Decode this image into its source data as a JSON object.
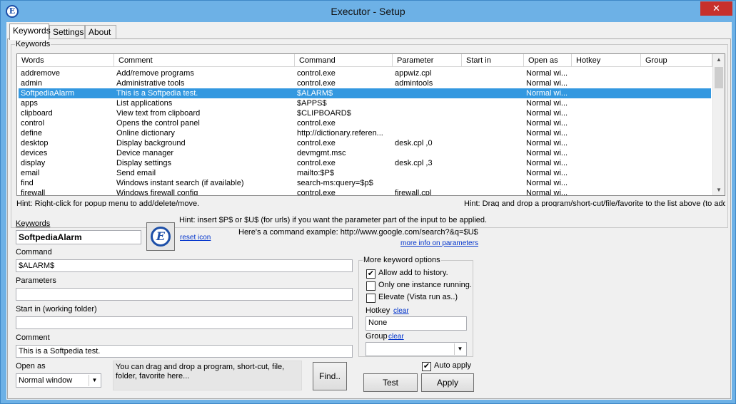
{
  "window": {
    "title": "Executor - Setup",
    "close_glyph": "✕",
    "app_icon": "executor-logo-icon",
    "app_icon_letter": "E"
  },
  "tabs": [
    {
      "label": "Keywords",
      "active": true
    },
    {
      "label": "Settings",
      "active": false
    },
    {
      "label": "About",
      "active": false
    }
  ],
  "keywords_group": {
    "label": "Keywords",
    "columns": [
      "Words",
      "Comment",
      "Command",
      "Parameter",
      "Start in",
      "Open as",
      "Hotkey",
      "Group"
    ],
    "rows": [
      {
        "words": "addremove",
        "comment": "Add/remove programs",
        "command": "control.exe",
        "parameter": "appwiz.cpl",
        "start_in": "",
        "open_as": "Normal wi...",
        "hotkey": "",
        "group": "",
        "selected": false
      },
      {
        "words": "admin",
        "comment": "Administrative tools",
        "command": "control.exe",
        "parameter": "admintools",
        "start_in": "",
        "open_as": "Normal wi...",
        "hotkey": "",
        "group": "",
        "selected": false
      },
      {
        "words": "SoftpediaAlarm",
        "comment": "This is a Softpedia test.",
        "command": "$ALARM$",
        "parameter": "",
        "start_in": "",
        "open_as": "Normal wi...",
        "hotkey": "",
        "group": "",
        "selected": true
      },
      {
        "words": "apps",
        "comment": "List applications",
        "command": "$APPS$",
        "parameter": "",
        "start_in": "",
        "open_as": "Normal wi...",
        "hotkey": "",
        "group": "",
        "selected": false
      },
      {
        "words": "clipboard",
        "comment": "View text from clipboard",
        "command": "$CLIPBOARD$",
        "parameter": "",
        "start_in": "",
        "open_as": "Normal wi...",
        "hotkey": "",
        "group": "",
        "selected": false
      },
      {
        "words": "control",
        "comment": "Opens the control panel",
        "command": "control.exe",
        "parameter": "",
        "start_in": "",
        "open_as": "Normal wi...",
        "hotkey": "",
        "group": "",
        "selected": false
      },
      {
        "words": "define",
        "comment": "Online dictionary",
        "command": "http://dictionary.referen...",
        "parameter": "",
        "start_in": "",
        "open_as": "Normal wi...",
        "hotkey": "",
        "group": "",
        "selected": false
      },
      {
        "words": "desktop",
        "comment": "Display background",
        "command": "control.exe",
        "parameter": "desk.cpl ,0",
        "start_in": "",
        "open_as": "Normal wi...",
        "hotkey": "",
        "group": "",
        "selected": false
      },
      {
        "words": "devices",
        "comment": "Device manager",
        "command": "devmgmt.msc",
        "parameter": "",
        "start_in": "",
        "open_as": "Normal wi...",
        "hotkey": "",
        "group": "",
        "selected": false
      },
      {
        "words": "display",
        "comment": "Display settings",
        "command": "control.exe",
        "parameter": "desk.cpl ,3",
        "start_in": "",
        "open_as": "Normal wi...",
        "hotkey": "",
        "group": "",
        "selected": false
      },
      {
        "words": "email",
        "comment": "Send email",
        "command": "mailto:$P$",
        "parameter": "",
        "start_in": "",
        "open_as": "Normal wi...",
        "hotkey": "",
        "group": "",
        "selected": false
      },
      {
        "words": "find",
        "comment": "Windows instant search (if available)",
        "command": "search-ms:query=$p$",
        "parameter": "",
        "start_in": "",
        "open_as": "Normal wi...",
        "hotkey": "",
        "group": "",
        "selected": false
      },
      {
        "words": "firewall",
        "comment": "Windows firewall config",
        "command": "control.exe",
        "parameter": "firewall.cpl",
        "start_in": "",
        "open_as": "Normal wi...",
        "hotkey": "",
        "group": "",
        "selected": false
      }
    ],
    "hint_left": "Hint: Right-click for popup menu to add/delete/move.",
    "hint_right": "Hint: Drag and drop a program/short-cut/file/favorite to the list above (to add)"
  },
  "editor": {
    "keywords_label": "Keywords",
    "keywords_value": "SoftpediaAlarm",
    "reset_icon_link": "reset icon",
    "hint1": "Hint: insert $P$ or $U$ (for urls) if you want the parameter part of the input to be applied.",
    "hint2": "Here's a command example: http://www.google.com/search?&q=$U$",
    "more_info_link": "more info on parameters",
    "command_label": "Command",
    "command_value": "$ALARM$",
    "parameters_label": "Parameters",
    "parameters_value": "",
    "startin_label": "Start in (working folder)",
    "startin_value": "",
    "comment_label": "Comment",
    "comment_value": "This is a Softpedia test.",
    "openas_label": "Open as",
    "openas_value": "Normal window",
    "dropzone_text": "You can drag and drop a program, short-cut, file, folder, favorite here...",
    "find_button": "Find.."
  },
  "options": {
    "group_label": "More keyword options",
    "allow_history": {
      "label": "Allow add to history.",
      "checked": true
    },
    "one_instance": {
      "label": "Only one instance running.",
      "checked": false
    },
    "elevate": {
      "label": "Elevate (Vista run as..)",
      "checked": false
    },
    "hotkey_label": "Hotkey",
    "hotkey_clear": "clear",
    "hotkey_value": "None",
    "group_field_label": "Group",
    "group_clear": "clear",
    "group_value": ""
  },
  "footer": {
    "auto_apply": {
      "label": "Auto apply",
      "checked": true
    },
    "test_button": "Test",
    "apply_button": "Apply"
  },
  "colors": {
    "titlebar": "#6db1e6",
    "selection": "#3398e0",
    "close": "#c7302b"
  }
}
